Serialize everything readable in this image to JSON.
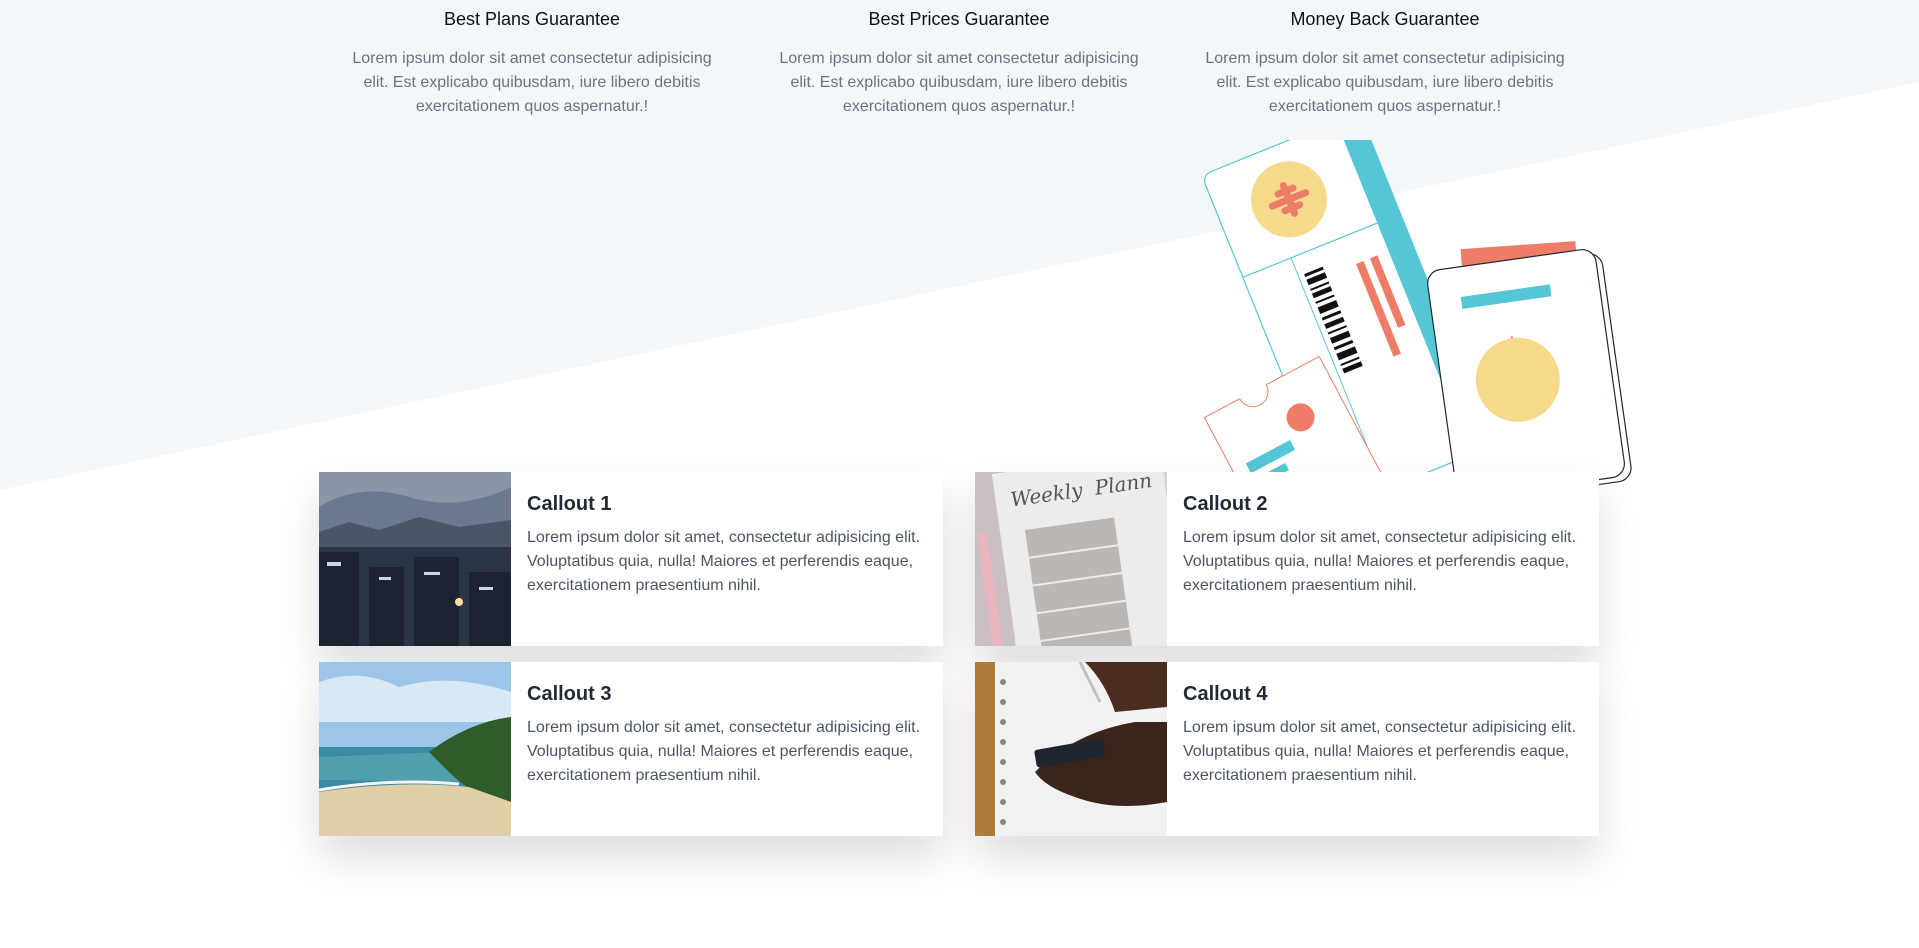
{
  "features": [
    {
      "title": "Best Plans Guarantee",
      "text": "Lorem ipsum dolor sit amet consectetur adipisicing elit. Est explicabo quibusdam, iure libero debitis exercitationem quos aspernatur.!"
    },
    {
      "title": "Best Prices Guarantee",
      "text": "Lorem ipsum dolor sit amet consectetur adipisicing elit. Est explicabo quibusdam, iure libero debitis exercitationem quos aspernatur.!"
    },
    {
      "title": "Money Back Guarantee",
      "text": "Lorem ipsum dolor sit amet consectetur adipisicing elit. Est explicabo quibusdam, iure libero debitis exercitationem quos aspernatur.!"
    }
  ],
  "callouts": [
    {
      "title": "Callout 1",
      "text": "Lorem ipsum dolor sit amet, consectetur adipisicing elit. Voluptatibus quia, nulla! Maiores et perferendis eaque, exercitationem praesentium nihil.",
      "image": "city-at-dusk-photo"
    },
    {
      "title": "Callout 2",
      "text": "Lorem ipsum dolor sit amet, consectetur adipisicing elit. Voluptatibus quia, nulla! Maiores et perferendis eaque, exercitationem praesentium nihil.",
      "image": "weekly-planner-photo"
    },
    {
      "title": "Callout 3",
      "text": "Lorem ipsum dolor sit amet, consectetur adipisicing elit. Voluptatibus quia, nulla! Maiores et perferendis eaque, exercitationem praesentium nihil.",
      "image": "beach-photo"
    },
    {
      "title": "Callout 4",
      "text": "Lorem ipsum dolor sit amet, consectetur adipisicing elit. Voluptatibus quia, nulla! Maiores et perferendis eaque, exercitationem praesentium nihil.",
      "image": "writing-notebook-photo"
    }
  ],
  "colors": {
    "section_bg": "#f4f7fa",
    "accent_teal": "#54c6d6",
    "accent_coral": "#ee7d68",
    "accent_yellow": "#f7d98c"
  },
  "illustration": "travel-tickets-illustration"
}
